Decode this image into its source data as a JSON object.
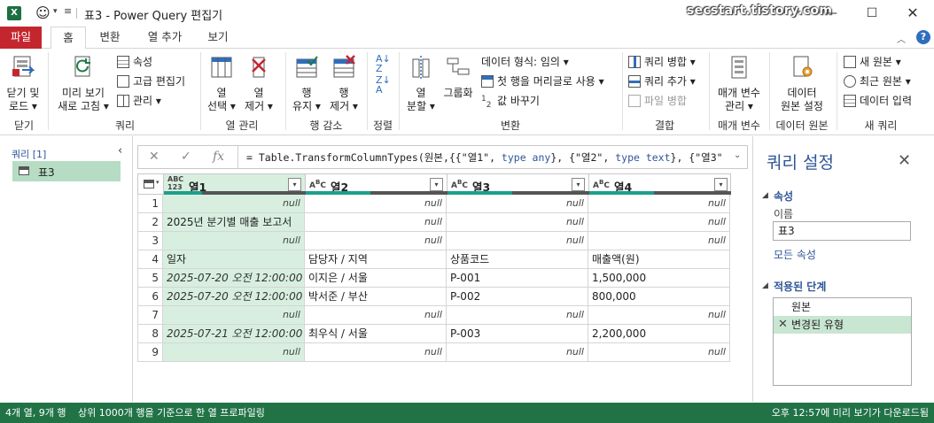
{
  "window": {
    "title": "표3 - Power Query 편집기",
    "watermark": "secstart.tistory.com"
  },
  "tabs": [
    {
      "label": "파일"
    },
    {
      "label": "홈"
    },
    {
      "label": "변환"
    },
    {
      "label": "열 추가"
    },
    {
      "label": "보기"
    }
  ],
  "ribbon": {
    "close": {
      "btn1": "닫기 및",
      "btn1b": "로드 ▾",
      "group": "닫기"
    },
    "query": {
      "refresh1": "미리 보기",
      "refresh2": "새로 고침 ▾",
      "properties": "속성",
      "advanced": "고급 편집기",
      "manage": "관리 ▾",
      "group": "쿼리"
    },
    "columns": {
      "choose1": "열",
      "choose2": "선택 ▾",
      "remove1": "열",
      "remove2": "제거 ▾",
      "group": "열 관리"
    },
    "rows": {
      "keep1": "행",
      "keep2": "유지 ▾",
      "remove1": "행",
      "remove2": "제거 ▾",
      "group": "행 감소"
    },
    "sort": {
      "group": "정렬"
    },
    "transform": {
      "split1": "열",
      "split2": "분할 ▾",
      "groupby": "그룹화",
      "datatype": "데이터 형식: 임의 ▾",
      "firstrow": "첫 행을 머리글로 사용 ▾",
      "replace": "값 바꾸기",
      "group": "변환"
    },
    "combine": {
      "merge": "쿼리 병합 ▾",
      "append": "쿼리 추가 ▾",
      "combinefiles": "파일 병합",
      "group": "결합"
    },
    "params": {
      "manage1": "매개 변수",
      "manage2": "관리 ▾",
      "group": "매개 변수"
    },
    "datasource": {
      "settings1": "데이터",
      "settings2": "원본 설정",
      "group": "데이터 원본"
    },
    "newquery": {
      "newsource": "새 원본 ▾",
      "recent": "최근 원본 ▾",
      "enter": "데이터 입력",
      "group": "새 쿼리"
    }
  },
  "queries": {
    "header": "쿼리 [1]",
    "items": [
      {
        "label": "표3"
      }
    ]
  },
  "formula": {
    "text_a": "= Table.TransformColumnTypes(원본,{{\"열1\", ",
    "kw1": "type any",
    "text_b": "}, {\"열2\", ",
    "kw2": "type text",
    "text_c": "}, {\"열3\","
  },
  "grid": {
    "columns": [
      {
        "type": "ABC\n123",
        "name": "열1"
      },
      {
        "type": "A B C",
        "name": "열2"
      },
      {
        "type": "A B C",
        "name": "열3"
      },
      {
        "type": "A B C",
        "name": "열4"
      }
    ],
    "rows": [
      {
        "n": "1",
        "c": [
          "null",
          "null",
          "null",
          "null"
        ]
      },
      {
        "n": "2",
        "c": [
          "2025년 분기별 매출 보고서",
          "null",
          "null",
          "null"
        ]
      },
      {
        "n": "3",
        "c": [
          "null",
          "null",
          "null",
          "null"
        ]
      },
      {
        "n": "4",
        "c": [
          "일자",
          "담당자 / 지역",
          "상품코드",
          "매출액(원)"
        ]
      },
      {
        "n": "5",
        "c": [
          "2025-07-20 오전 12:00:00",
          "이지은 / 서울",
          "P-001",
          "1,500,000"
        ]
      },
      {
        "n": "6",
        "c": [
          "2025-07-20 오전 12:00:00",
          "박서준 / 부산",
          "P-002",
          "800,000"
        ]
      },
      {
        "n": "7",
        "c": [
          "null",
          "null",
          "null",
          "null"
        ]
      },
      {
        "n": "8",
        "c": [
          "2025-07-21 오전 12:00:00",
          "최우식 / 서울",
          "P-003",
          "2,200,000"
        ]
      },
      {
        "n": "9",
        "c": [
          "null",
          "null",
          "null",
          "null"
        ]
      }
    ]
  },
  "settings": {
    "title": "쿼리 설정",
    "props_header": "속성",
    "name_label": "이름",
    "name_value": "표3",
    "all_props": "모든 속성",
    "steps_header": "적용된 단계",
    "steps": [
      {
        "label": "원본"
      },
      {
        "label": "변경된 유형"
      }
    ]
  },
  "status": {
    "left1": "4개 열, 9개 행",
    "left2": "상위 1000개 행을 기준으로 한 열 프로파일링",
    "right": "오후 12:57에 미리 보기가 다운로드됨"
  },
  "colors": {
    "file_tab": "#c4262e",
    "status_bar": "#217346",
    "accent_blue": "#2f5597",
    "selection": "#d8efe0"
  }
}
